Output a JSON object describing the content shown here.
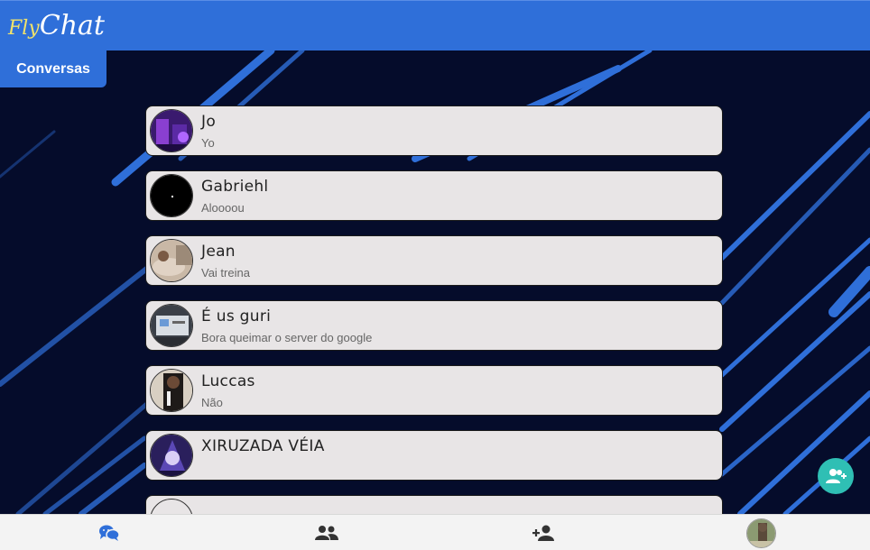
{
  "app": {
    "logo_part1": "Fly",
    "logo_part2": "Chat"
  },
  "tab": {
    "label": "Conversas"
  },
  "conversations": [
    {
      "name": "Jo",
      "last_message": "Yo"
    },
    {
      "name": "Gabriehl",
      "last_message": "Aloooou"
    },
    {
      "name": "Jean",
      "last_message": "Vai treina"
    },
    {
      "name": "É us guri",
      "last_message": "Bora queimar o server do google"
    },
    {
      "name": "Luccas",
      "last_message": "Não"
    },
    {
      "name": "XIRUZADA VÉIA",
      "last_message": ""
    },
    {
      "name": "",
      "last_message": ""
    }
  ],
  "bottom_nav": [
    {
      "icon": "chat-bubbles-icon"
    },
    {
      "icon": "users-icon"
    },
    {
      "icon": "add-user-icon"
    },
    {
      "icon": "profile-avatar"
    }
  ],
  "colors": {
    "header": "#2f6fd9",
    "background": "#050c2b",
    "stripe": "#2f6fd9",
    "card": "#e8e5e6",
    "fab": "#2fbfb4",
    "nav_icon_active": "#2f6fd9",
    "nav_icon": "#333333"
  }
}
